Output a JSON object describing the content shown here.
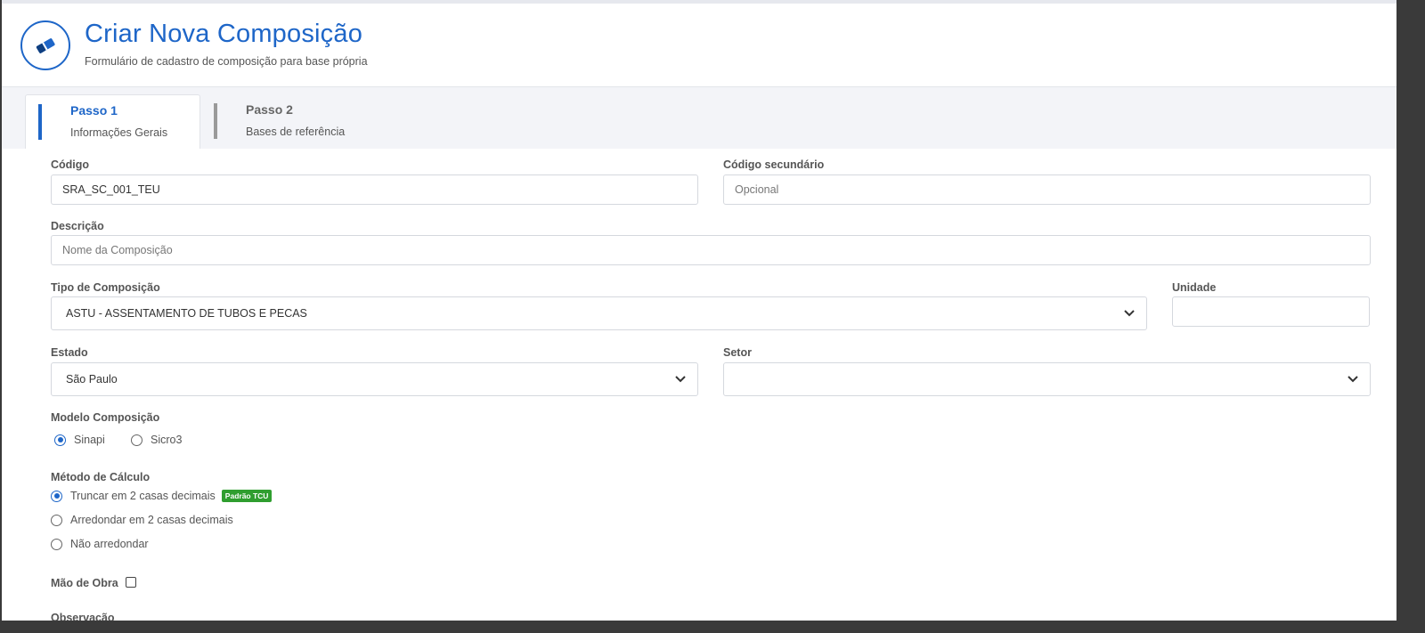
{
  "header": {
    "title": "Criar Nova Composição",
    "subtitle": "Formulário de cadastro de composição para base própria",
    "icon": "eraser-icon"
  },
  "tabs": [
    {
      "title": "Passo 1",
      "subtitle": "Informações Gerais",
      "active": true
    },
    {
      "title": "Passo 2",
      "subtitle": "Bases de referência",
      "active": false
    }
  ],
  "form": {
    "codigo": {
      "label": "Código",
      "value": "SRA_SC_001_TEU"
    },
    "codigo_secundario": {
      "label": "Código secundário",
      "placeholder": "Opcional"
    },
    "descricao": {
      "label": "Descrição",
      "placeholder": "Nome da Composição"
    },
    "tipo": {
      "label": "Tipo de Composição",
      "value": "ASTU - ASSENTAMENTO DE TUBOS E PECAS"
    },
    "unidade": {
      "label": "Unidade",
      "value": ""
    },
    "estado": {
      "label": "Estado",
      "value": "São Paulo"
    },
    "setor": {
      "label": "Setor",
      "value": ""
    },
    "modelo": {
      "label": "Modelo Composição",
      "options": [
        {
          "label": "Sinapi",
          "selected": true
        },
        {
          "label": "Sicro3",
          "selected": false
        }
      ]
    },
    "metodo": {
      "label": "Método de Cálculo",
      "badge": "Padrão TCU",
      "options": [
        {
          "label": "Truncar em 2 casas decimais",
          "selected": true
        },
        {
          "label": "Arredondar em 2 casas decimais",
          "selected": false
        },
        {
          "label": "Não arredondar",
          "selected": false
        }
      ]
    },
    "mao_de_obra": {
      "label": "Mão de Obra",
      "checked": false
    },
    "observacao": {
      "label": "Observação"
    }
  },
  "colors": {
    "accent": "#1e66c8",
    "badge": "#2f9e2f"
  }
}
